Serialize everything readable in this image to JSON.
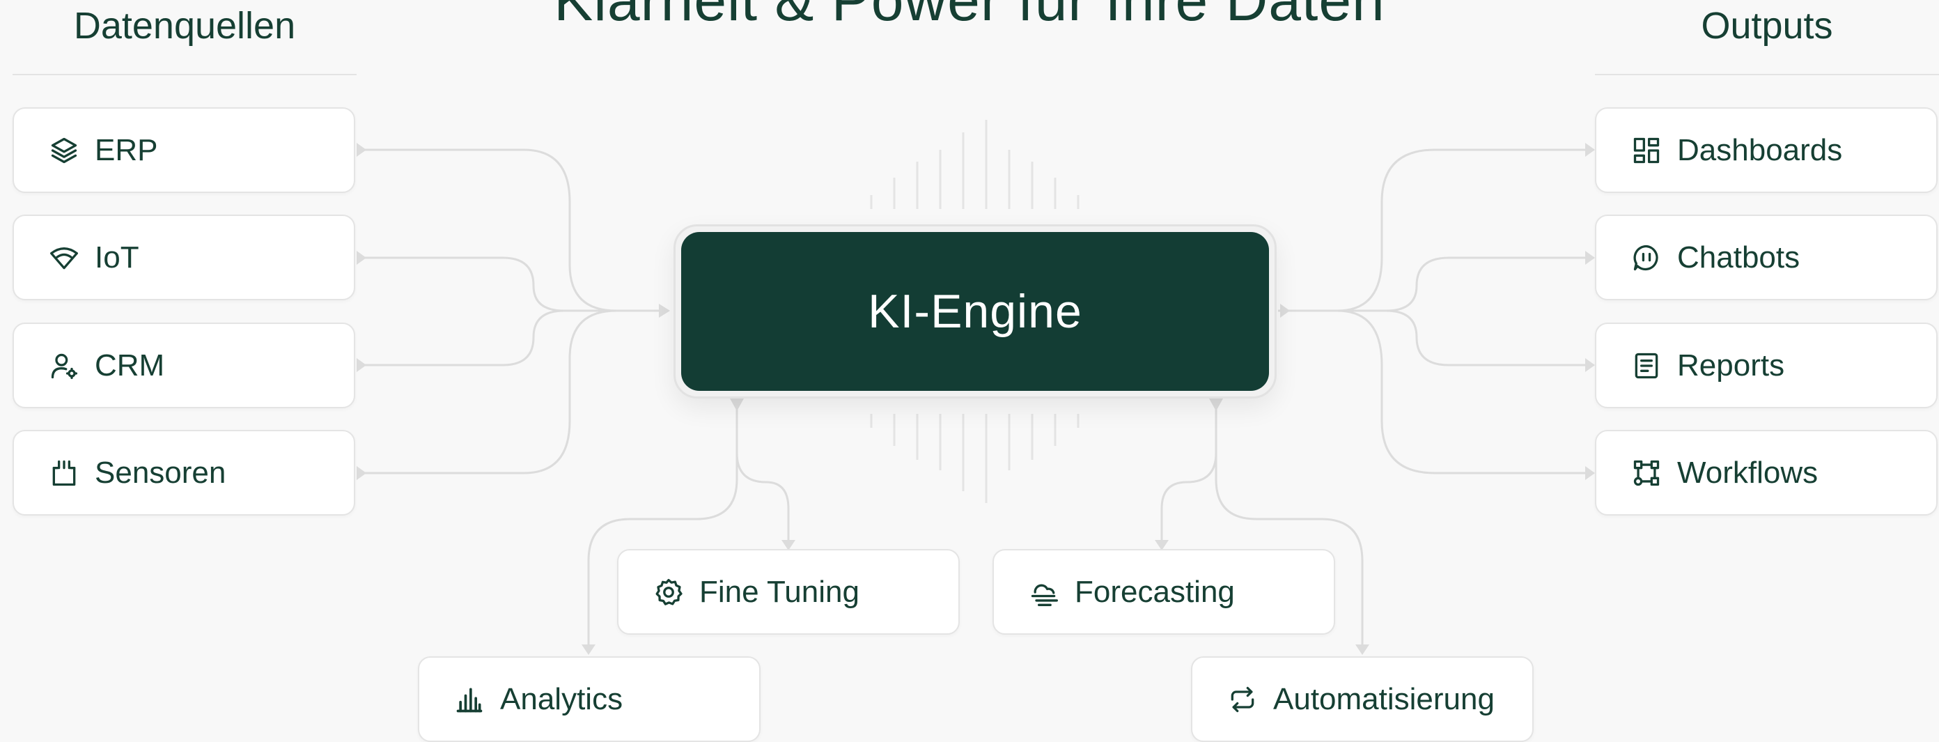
{
  "page": {
    "title": "Klarheit & Power für Ihre Daten",
    "left_heading": "Datenquellen",
    "right_heading": "Outputs"
  },
  "engine": {
    "label": "KI-Engine"
  },
  "sources": [
    {
      "label": "ERP",
      "icon": "layers-icon"
    },
    {
      "label": "IoT",
      "icon": "wifi-icon"
    },
    {
      "label": "CRM",
      "icon": "user-settings-icon"
    },
    {
      "label": "Sensoren",
      "icon": "sensor-icon"
    }
  ],
  "outputs": [
    {
      "label": "Dashboards",
      "icon": "dashboard-icon"
    },
    {
      "label": "Chatbots",
      "icon": "chatbot-icon"
    },
    {
      "label": "Reports",
      "icon": "report-icon"
    },
    {
      "label": "Workflows",
      "icon": "workflow-icon"
    }
  ],
  "capabilities": [
    {
      "label": "Fine Tuning",
      "icon": "gear-icon"
    },
    {
      "label": "Forecasting",
      "icon": "cloud-forecast-icon"
    },
    {
      "label": "Analytics",
      "icon": "bar-chart-icon"
    },
    {
      "label": "Automatisierung",
      "icon": "repeat-icon"
    }
  ],
  "colors": {
    "accent": "#133d34",
    "text": "#163f33",
    "background": "#f8f8f8",
    "card": "#ffffff",
    "connector": "#dcdcdc"
  }
}
